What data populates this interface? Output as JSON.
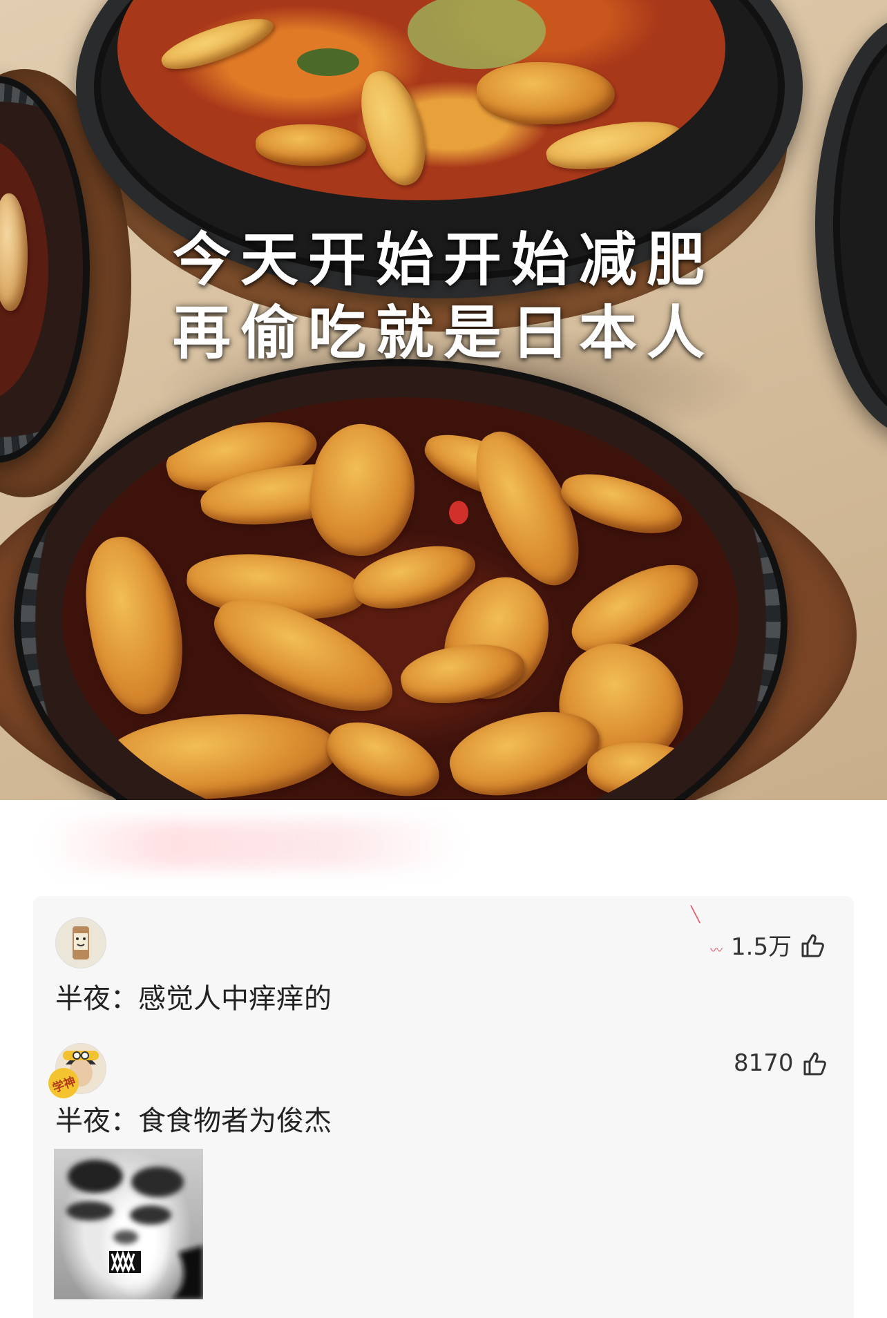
{
  "post": {
    "caption_line1": "今天开始开始减肥",
    "caption_line2": "再偷吃就是日本人"
  },
  "comments": [
    {
      "author": "半夜",
      "separator": "：",
      "text": "感觉人中痒痒的",
      "likes": "1.5万",
      "avatar_icon": "cartoon-avatar"
    },
    {
      "author": "半夜",
      "separator": "：",
      "text": "食食物者为俊杰",
      "likes": "8170",
      "avatar_icon": "cartoon-avatar",
      "avatar_badge": "学神",
      "has_sticker_image": true
    }
  ],
  "colors": {
    "panel_bg": "#f7f7f7",
    "text": "#222222",
    "likes_text": "#333333"
  }
}
